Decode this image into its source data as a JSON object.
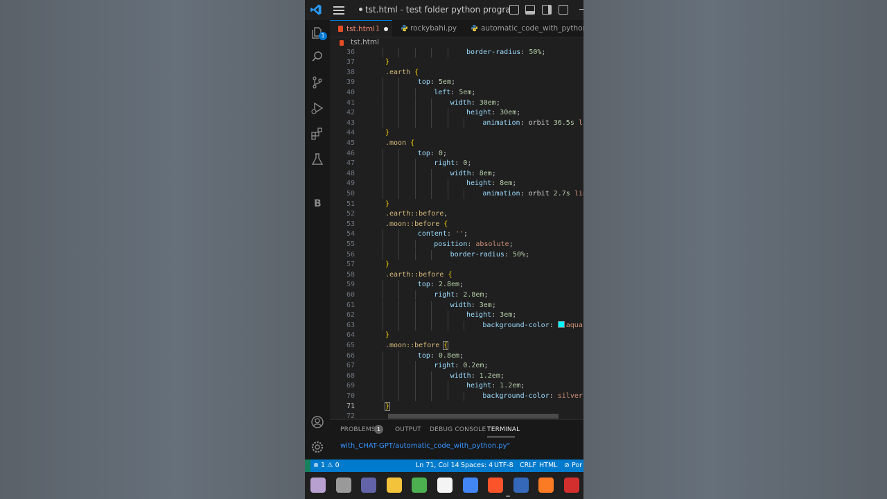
{
  "window": {
    "title": "tst.html - test folder python program...",
    "unsaved_dot": "●"
  },
  "activity_bar": {
    "explorer_badge": "1",
    "b_icon": "B"
  },
  "tabs": [
    {
      "label": "tst.html",
      "problems": "1",
      "modified": true,
      "icon": "html-icon"
    },
    {
      "label": "rockybahi.py",
      "icon": "python-icon"
    },
    {
      "label": "automatic_code_with_python.py",
      "icon": "python-icon"
    }
  ],
  "breadcrumb": {
    "file": "tst.html"
  },
  "editor": {
    "current_line": "71",
    "swatch_color": "#00ffff",
    "lines": [
      {
        "n": "36",
        "indent": 6,
        "parts": [
          {
            "t": "border-radius",
            "c": "prop"
          },
          {
            "t": ": ",
            "c": "punc"
          },
          {
            "t": "50%",
            "c": "val"
          },
          {
            "t": ";",
            "c": "punc"
          }
        ]
      },
      {
        "n": "37",
        "indent": 1,
        "parts": [
          {
            "t": "}",
            "c": "brace"
          }
        ]
      },
      {
        "n": "38",
        "indent": 1,
        "parts": [
          {
            "t": ".earth ",
            "c": "sel"
          },
          {
            "t": "{",
            "c": "brace"
          }
        ]
      },
      {
        "n": "39",
        "indent": 3,
        "parts": [
          {
            "t": "top",
            "c": "prop"
          },
          {
            "t": ": ",
            "c": "punc"
          },
          {
            "t": "5em",
            "c": "val"
          },
          {
            "t": ";",
            "c": "punc"
          }
        ]
      },
      {
        "n": "40",
        "indent": 4,
        "parts": [
          {
            "t": "left",
            "c": "prop"
          },
          {
            "t": ": ",
            "c": "punc"
          },
          {
            "t": "5em",
            "c": "val"
          },
          {
            "t": ";",
            "c": "punc"
          }
        ]
      },
      {
        "n": "41",
        "indent": 5,
        "parts": [
          {
            "t": "width",
            "c": "prop"
          },
          {
            "t": ": ",
            "c": "punc"
          },
          {
            "t": "30em",
            "c": "val"
          },
          {
            "t": ";",
            "c": "punc"
          }
        ]
      },
      {
        "n": "42",
        "indent": 6,
        "parts": [
          {
            "t": "height",
            "c": "prop"
          },
          {
            "t": ": ",
            "c": "punc"
          },
          {
            "t": "30em",
            "c": "val"
          },
          {
            "t": ";",
            "c": "punc"
          }
        ]
      },
      {
        "n": "43",
        "indent": 7,
        "parts": [
          {
            "t": "animation",
            "c": "prop"
          },
          {
            "t": ": ",
            "c": "punc"
          },
          {
            "t": "orbit ",
            "c": "punc"
          },
          {
            "t": "36.5s",
            "c": "val"
          },
          {
            "t": " lin",
            "c": "str"
          }
        ]
      },
      {
        "n": "44",
        "indent": 1,
        "parts": [
          {
            "t": "}",
            "c": "brace"
          }
        ]
      },
      {
        "n": "45",
        "indent": 1,
        "parts": [
          {
            "t": ".moon ",
            "c": "sel"
          },
          {
            "t": "{",
            "c": "brace"
          }
        ]
      },
      {
        "n": "46",
        "indent": 3,
        "parts": [
          {
            "t": "top",
            "c": "prop"
          },
          {
            "t": ": ",
            "c": "punc"
          },
          {
            "t": "0",
            "c": "val"
          },
          {
            "t": ";",
            "c": "punc"
          }
        ]
      },
      {
        "n": "47",
        "indent": 4,
        "parts": [
          {
            "t": "right",
            "c": "prop"
          },
          {
            "t": ": ",
            "c": "punc"
          },
          {
            "t": "0",
            "c": "val"
          },
          {
            "t": ";",
            "c": "punc"
          }
        ]
      },
      {
        "n": "48",
        "indent": 5,
        "parts": [
          {
            "t": "width",
            "c": "prop"
          },
          {
            "t": ": ",
            "c": "punc"
          },
          {
            "t": "8em",
            "c": "val"
          },
          {
            "t": ";",
            "c": "punc"
          }
        ]
      },
      {
        "n": "49",
        "indent": 6,
        "parts": [
          {
            "t": "height",
            "c": "prop"
          },
          {
            "t": ": ",
            "c": "punc"
          },
          {
            "t": "8em",
            "c": "val"
          },
          {
            "t": ";",
            "c": "punc"
          }
        ]
      },
      {
        "n": "50",
        "indent": 7,
        "parts": [
          {
            "t": "animation",
            "c": "prop"
          },
          {
            "t": ": ",
            "c": "punc"
          },
          {
            "t": "orbit ",
            "c": "punc"
          },
          {
            "t": "2.7s",
            "c": "val"
          },
          {
            "t": " line",
            "c": "str"
          }
        ]
      },
      {
        "n": "51",
        "indent": 1,
        "parts": [
          {
            "t": "}",
            "c": "brace"
          }
        ]
      },
      {
        "n": "52",
        "indent": 1,
        "parts": [
          {
            "t": ".earth::before",
            "c": "sel"
          },
          {
            "t": ",",
            "c": "punc"
          }
        ]
      },
      {
        "n": "53",
        "indent": 1,
        "parts": [
          {
            "t": ".moon::before ",
            "c": "sel"
          },
          {
            "t": "{",
            "c": "brace"
          }
        ]
      },
      {
        "n": "54",
        "indent": 3,
        "parts": [
          {
            "t": "content",
            "c": "prop"
          },
          {
            "t": ": ",
            "c": "punc"
          },
          {
            "t": "''",
            "c": "str"
          },
          {
            "t": ";",
            "c": "punc"
          }
        ]
      },
      {
        "n": "55",
        "indent": 4,
        "parts": [
          {
            "t": "position",
            "c": "prop"
          },
          {
            "t": ": ",
            "c": "punc"
          },
          {
            "t": "absolute",
            "c": "str"
          },
          {
            "t": ";",
            "c": "punc"
          }
        ]
      },
      {
        "n": "56",
        "indent": 5,
        "parts": [
          {
            "t": "border-radius",
            "c": "prop"
          },
          {
            "t": ": ",
            "c": "punc"
          },
          {
            "t": "50%",
            "c": "val"
          },
          {
            "t": ";",
            "c": "punc"
          }
        ]
      },
      {
        "n": "57",
        "indent": 1,
        "parts": [
          {
            "t": "}",
            "c": "brace"
          }
        ]
      },
      {
        "n": "58",
        "indent": 1,
        "parts": [
          {
            "t": ".earth::before ",
            "c": "sel"
          },
          {
            "t": "{",
            "c": "brace"
          }
        ]
      },
      {
        "n": "59",
        "indent": 3,
        "parts": [
          {
            "t": "top",
            "c": "prop"
          },
          {
            "t": ": ",
            "c": "punc"
          },
          {
            "t": "2.8em",
            "c": "val"
          },
          {
            "t": ";",
            "c": "punc"
          }
        ]
      },
      {
        "n": "60",
        "indent": 4,
        "parts": [
          {
            "t": "right",
            "c": "prop"
          },
          {
            "t": ": ",
            "c": "punc"
          },
          {
            "t": "2.8em",
            "c": "val"
          },
          {
            "t": ";",
            "c": "punc"
          }
        ]
      },
      {
        "n": "61",
        "indent": 5,
        "parts": [
          {
            "t": "width",
            "c": "prop"
          },
          {
            "t": ": ",
            "c": "punc"
          },
          {
            "t": "3em",
            "c": "val"
          },
          {
            "t": ";",
            "c": "punc"
          }
        ]
      },
      {
        "n": "62",
        "indent": 6,
        "parts": [
          {
            "t": "height",
            "c": "prop"
          },
          {
            "t": ": ",
            "c": "punc"
          },
          {
            "t": "3em",
            "c": "val"
          },
          {
            "t": ";",
            "c": "punc"
          }
        ]
      },
      {
        "n": "63",
        "indent": 7,
        "parts": [
          {
            "t": "background-color",
            "c": "prop"
          },
          {
            "t": ": ",
            "c": "punc"
          },
          {
            "t": "SWATCH",
            "c": "swatch"
          },
          {
            "t": "aqua",
            "c": "str"
          },
          {
            "t": ";",
            "c": "punc"
          }
        ]
      },
      {
        "n": "64",
        "indent": 1,
        "parts": [
          {
            "t": "}",
            "c": "brace"
          }
        ]
      },
      {
        "n": "65",
        "indent": 1,
        "parts": [
          {
            "t": ".moon::before ",
            "c": "sel"
          },
          {
            "t": "{",
            "c": "brace cursor-box"
          }
        ]
      },
      {
        "n": "66",
        "indent": 3,
        "parts": [
          {
            "t": "top",
            "c": "prop"
          },
          {
            "t": ": ",
            "c": "punc"
          },
          {
            "t": "0.8em",
            "c": "val"
          },
          {
            "t": ";",
            "c": "punc"
          }
        ]
      },
      {
        "n": "67",
        "indent": 4,
        "parts": [
          {
            "t": "right",
            "c": "prop"
          },
          {
            "t": ": ",
            "c": "punc"
          },
          {
            "t": "0.2em",
            "c": "val"
          },
          {
            "t": ";",
            "c": "punc"
          }
        ]
      },
      {
        "n": "68",
        "indent": 5,
        "parts": [
          {
            "t": "width",
            "c": "prop"
          },
          {
            "t": ": ",
            "c": "punc"
          },
          {
            "t": "1.2em",
            "c": "val"
          },
          {
            "t": ";",
            "c": "punc"
          }
        ]
      },
      {
        "n": "69",
        "indent": 6,
        "parts": [
          {
            "t": "height",
            "c": "prop"
          },
          {
            "t": ": ",
            "c": "punc"
          },
          {
            "t": "1.2em",
            "c": "val"
          },
          {
            "t": ";",
            "c": "punc"
          }
        ]
      },
      {
        "n": "70",
        "indent": 7,
        "parts": [
          {
            "t": "background-color",
            "c": "prop"
          },
          {
            "t": ": ",
            "c": "punc"
          },
          {
            "t": "silver",
            "c": "str"
          },
          {
            "t": ";",
            "c": "punc"
          }
        ]
      },
      {
        "n": "71",
        "indent": 1,
        "parts": [
          {
            "t": "}",
            "c": "brace cursor-box"
          }
        ]
      },
      {
        "n": "72",
        "indent": 1,
        "parts": [
          {
            "t": "",
            "c": "punc"
          }
        ]
      }
    ]
  },
  "panel": {
    "tabs": [
      {
        "label": "PROBLEMS",
        "badge": "1"
      },
      {
        "label": "OUTPUT"
      },
      {
        "label": "DEBUG CONSOLE"
      },
      {
        "label": "TERMINAL",
        "active": true
      }
    ],
    "terminal_text": "with_CHAT-GPT/automatic_code_with_python.py\""
  },
  "status_bar": {
    "errors": "⊗ 1 ⚠ 0",
    "position": "Ln 71, Col 14",
    "spaces": "Spaces: 4",
    "encoding": "UTF-8",
    "eol": "CRLF",
    "language": "HTML",
    "port": "⊘ Por"
  },
  "colors": {
    "accent": "#007acc",
    "editor_bg": "#1f1f1f",
    "html_icon": "#e44d26"
  },
  "taskbar": [
    {
      "name": "paint-app-icon",
      "color": "#b8a0d0"
    },
    {
      "name": "task-view-icon",
      "color": "#9a9a9a"
    },
    {
      "name": "teams-chat-icon",
      "color": "#6264a7"
    },
    {
      "name": "file-explorer-icon",
      "color": "#f3c33b"
    },
    {
      "name": "stack-app-icon",
      "color": "#4caf50"
    },
    {
      "name": "store-icon",
      "color": "#f4f4f4"
    },
    {
      "name": "chrome-icon",
      "color": "#4285f4"
    },
    {
      "name": "brave-icon",
      "color": "#fb542b"
    },
    {
      "name": "powershell-icon",
      "color": "#3568b8"
    },
    {
      "name": "xampp-icon",
      "color": "#fb7a24"
    },
    {
      "name": "app-red-icon",
      "color": "#d32f2f"
    }
  ]
}
